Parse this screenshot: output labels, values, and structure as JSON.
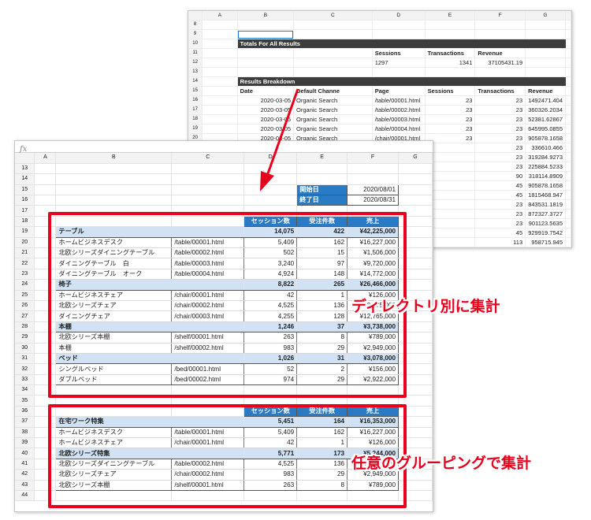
{
  "back_sheet": {
    "columns": [
      "A",
      "B",
      "C",
      "D",
      "E",
      "F",
      "G"
    ],
    "rows": [
      {
        "n": "8",
        "cells": [
          "",
          "",
          "",
          "",
          "",
          ""
        ]
      },
      {
        "n": "9",
        "cells": [
          "",
          "",
          "",
          "",
          "",
          ""
        ],
        "sel": true
      },
      {
        "n": "10",
        "band": "Totals For All Results"
      },
      {
        "n": "11",
        "cells": [
          "",
          "",
          "Sessions",
          "Transactions",
          "Revenue",
          ""
        ],
        "hdr": true
      },
      {
        "n": "12",
        "cells": [
          "",
          "",
          "1297",
          "1341",
          "37105431.19",
          ""
        ]
      },
      {
        "n": "13",
        "cells": [
          "",
          "",
          "",
          "",
          "",
          ""
        ]
      },
      {
        "n": "14",
        "band": "Results Breakdown"
      },
      {
        "n": "15",
        "cells": [
          "Date",
          "Default Channe",
          "Page",
          "Sessions",
          "Transactions",
          "Revenue"
        ],
        "hdr": true
      },
      {
        "n": "16",
        "cells": [
          "2020-03-05",
          "Organic Search",
          "/table/00001.html",
          "23",
          "23",
          "1492471.404"
        ]
      },
      {
        "n": "17",
        "cells": [
          "2020-03-05",
          "Organic Search",
          "/table/00002.html",
          "23",
          "23",
          "360326.2034"
        ]
      },
      {
        "n": "18",
        "cells": [
          "2020-03-05",
          "Organic Search",
          "/table/00003.html",
          "23",
          "23",
          "52381.62867"
        ]
      },
      {
        "n": "19",
        "cells": [
          "2020-03-05",
          "Organic Search",
          "/table/00004.html",
          "23",
          "23",
          "645995.0855"
        ]
      },
      {
        "n": "20",
        "cells": [
          "2020-03-05",
          "Organic Search",
          "/chair/00001.html",
          "23",
          "23",
          "905878.1658"
        ]
      },
      {
        "n": "",
        "cells": [
          "",
          "",
          "",
          "",
          "23",
          "336610.466"
        ]
      },
      {
        "n": "",
        "cells": [
          "",
          "",
          "",
          "",
          "23",
          "319284.9273"
        ]
      },
      {
        "n": "",
        "cells": [
          "",
          "",
          "",
          "",
          "23",
          "225884.5233"
        ]
      },
      {
        "n": "",
        "cells": [
          "",
          "",
          "",
          "",
          "90",
          "318114.8909"
        ]
      },
      {
        "n": "",
        "cells": [
          "",
          "",
          "",
          "",
          "45",
          "905878.1658"
        ]
      },
      {
        "n": "",
        "cells": [
          "",
          "",
          "",
          "",
          "45",
          "1815468.947"
        ]
      },
      {
        "n": "",
        "cells": [
          "",
          "",
          "",
          "",
          "23",
          "843531.1819"
        ]
      },
      {
        "n": "",
        "cells": [
          "",
          "",
          "",
          "",
          "23",
          "872327.3727"
        ]
      },
      {
        "n": "",
        "cells": [
          "",
          "",
          "",
          "",
          "23",
          "901123.5635"
        ]
      },
      {
        "n": "",
        "cells": [
          "",
          "",
          "",
          "",
          "45",
          "929919.7542"
        ]
      },
      {
        "n": "",
        "cells": [
          "",
          "",
          "",
          "",
          "113",
          "958715.945"
        ]
      }
    ]
  },
  "front_sheet": {
    "fx": "fx",
    "columns": [
      "A",
      "B",
      "C",
      "D",
      "E",
      "F",
      "G"
    ],
    "period": {
      "start_label": "開始日",
      "start": "2020/08/01",
      "end_label": "終了日",
      "end": "2020/08/31"
    },
    "headers": {
      "sessions": "セッション数",
      "orders": "受注件数",
      "sales": "売上"
    },
    "table1": [
      {
        "type": "group",
        "name": "テーブル",
        "s": "14,075",
        "o": "422",
        "v": "¥42,225,000"
      },
      {
        "type": "item",
        "name": "ホームビジネスデスク",
        "p": "/table/00001.html",
        "s": "5,409",
        "o": "162",
        "v": "¥16,227,000"
      },
      {
        "type": "item",
        "name": "北欧シリーズダイニングテーブル",
        "p": "/table/00002.html",
        "s": "502",
        "o": "15",
        "v": "¥1,506,000"
      },
      {
        "type": "item",
        "name": "ダイニングテーブル　白",
        "p": "/table/00003.html",
        "s": "3,240",
        "o": "97",
        "v": "¥9,720,000"
      },
      {
        "type": "item",
        "name": "ダイニングテーブル　オーク",
        "p": "/table/00004.html",
        "s": "4,924",
        "o": "148",
        "v": "¥14,772,000"
      },
      {
        "type": "group",
        "name": "椅子",
        "s": "8,822",
        "o": "265",
        "v": "¥26,466,000"
      },
      {
        "type": "item",
        "name": "ホームビジネスチェア",
        "p": "/chair/00001.html",
        "s": "42",
        "o": "1",
        "v": "¥126,000"
      },
      {
        "type": "item",
        "name": "北欧シリーズチェア",
        "p": "/chair/00002.html",
        "s": "4,525",
        "o": "136",
        "v": "¥13,575,000"
      },
      {
        "type": "item",
        "name": "ダイニングチェア",
        "p": "/chair/00003.html",
        "s": "4,255",
        "o": "128",
        "v": "¥12,765,000"
      },
      {
        "type": "group",
        "name": "本棚",
        "s": "1,246",
        "o": "37",
        "v": "¥3,738,000"
      },
      {
        "type": "item",
        "name": "北欧シリーズ本棚",
        "p": "/shelf/00001.html",
        "s": "263",
        "o": "8",
        "v": "¥789,000"
      },
      {
        "type": "item",
        "name": "本棚",
        "p": "/shelf/00002.html",
        "s": "983",
        "o": "29",
        "v": "¥2,949,000"
      },
      {
        "type": "group",
        "name": "ベッド",
        "s": "1,026",
        "o": "31",
        "v": "¥3,078,000"
      },
      {
        "type": "item",
        "name": "シングルベッド",
        "p": "/bed/00001.html",
        "s": "52",
        "o": "2",
        "v": "¥156,000"
      },
      {
        "type": "item",
        "name": "ダブルベッド",
        "p": "/bed/00002.html",
        "s": "974",
        "o": "29",
        "v": "¥2,922,000"
      }
    ],
    "table2": [
      {
        "type": "group",
        "name": "在宅ワーク特集",
        "s": "5,451",
        "o": "164",
        "v": "¥16,353,000"
      },
      {
        "type": "item",
        "name": "ホームビジネスデスク",
        "p": "/table/00001.html",
        "s": "5,409",
        "o": "162",
        "v": "¥16,227,000"
      },
      {
        "type": "item",
        "name": "ホームビジネスチェア",
        "p": "/chair/00001.html",
        "s": "42",
        "o": "1",
        "v": "¥126,000"
      },
      {
        "type": "group",
        "name": "北欧シリーズ特集",
        "s": "5,771",
        "o": "173",
        "v": "¥5,244,000"
      },
      {
        "type": "item",
        "name": "北欧シリーズダイニングテーブル",
        "p": "/table/00002.html",
        "s": "4,525",
        "o": "136",
        "v": "¥1,506,000"
      },
      {
        "type": "item",
        "name": "北欧シリーズチェア",
        "p": "/chair/00002.html",
        "s": "983",
        "o": "29",
        "v": "¥2,949,000"
      },
      {
        "type": "item",
        "name": "北欧シリーズ本棚",
        "p": "/shelf/00001.html",
        "s": "263",
        "o": "8",
        "v": "¥789,000"
      }
    ]
  },
  "annotations": {
    "callout_directory": "ディレクトリ別に集計",
    "callout_grouping": "任意のグルーピングで集計",
    "accent_color": "#e8001c",
    "table_header_color": "#2b7bc4",
    "group_row_color": "#d0e2f3"
  }
}
